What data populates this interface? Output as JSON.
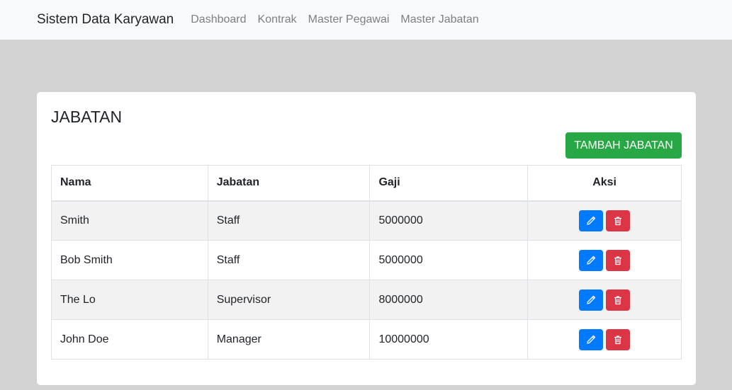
{
  "navbar": {
    "brand": "Sistem Data Karyawan",
    "links": [
      "Dashboard",
      "Kontrak",
      "Master Pegawai",
      "Master Jabatan"
    ]
  },
  "main": {
    "title": "JABATAN",
    "add_button_label": "TAMBAH JABATAN",
    "table": {
      "headers": [
        "Nama",
        "Jabatan",
        "Gaji",
        "Aksi"
      ],
      "rows": [
        {
          "nama": "Smith",
          "jabatan": "Staff",
          "gaji": "5000000"
        },
        {
          "nama": "Bob Smith",
          "jabatan": "Staff",
          "gaji": "5000000"
        },
        {
          "nama": "The Lo",
          "jabatan": "Supervisor",
          "gaji": "8000000"
        },
        {
          "nama": "John Doe",
          "jabatan": "Manager",
          "gaji": "10000000"
        }
      ]
    }
  },
  "icons": {
    "edit": "pencil-icon",
    "delete": "trash-icon"
  },
  "colors": {
    "page_background": "#d3d3d3",
    "navbar_background": "#f8f9fa",
    "add_button": "#28a745",
    "edit_button": "#007bff",
    "delete_button": "#dc3545",
    "striped_row": "#f2f2f2"
  }
}
